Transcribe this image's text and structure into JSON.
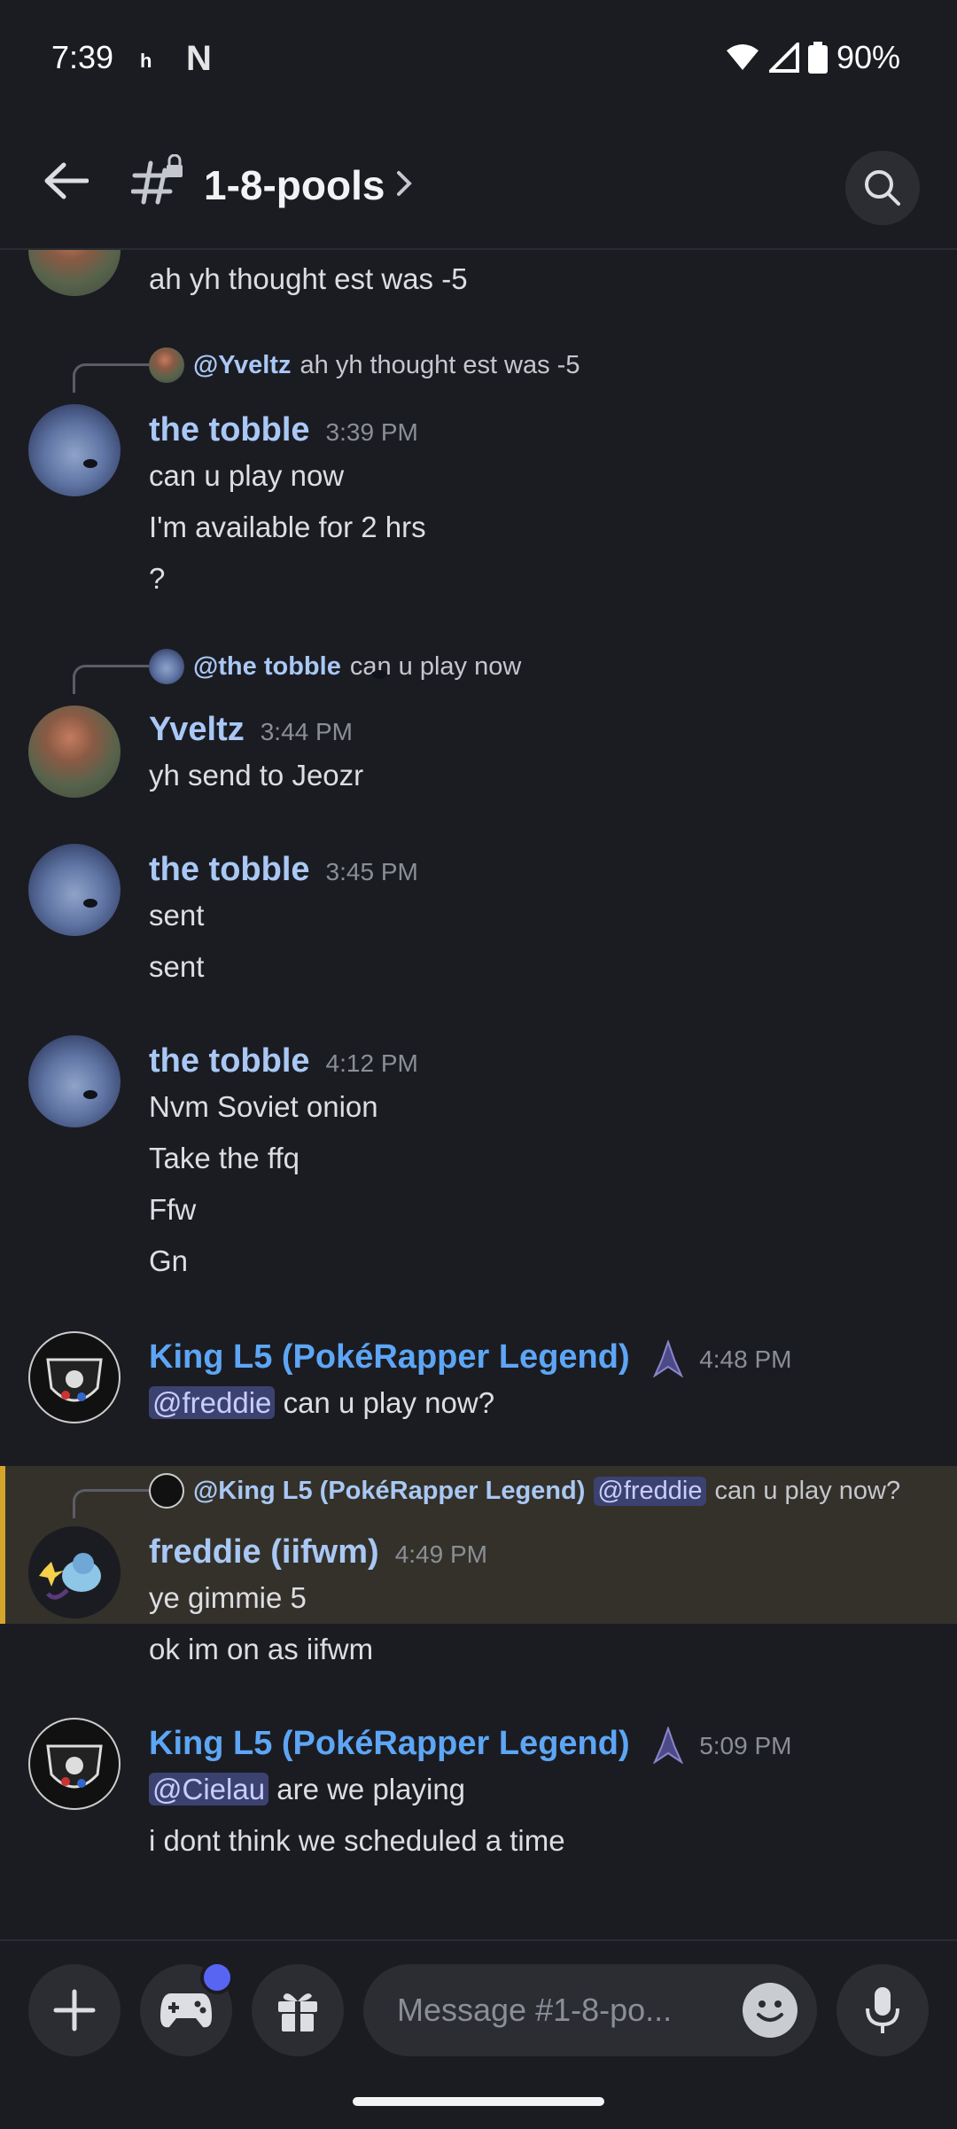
{
  "status_bar": {
    "time": "7:39",
    "app_h": "h",
    "app_n": "N",
    "battery": "90%"
  },
  "header": {
    "channel_name": "1-8-pools"
  },
  "messages": {
    "m0": {
      "text": "ah yh thought est was -5"
    },
    "m1": {
      "reply_name": "@Yveltz",
      "reply_text": "ah yh thought est was -5",
      "author": "the tobble",
      "time": "3:39 PM",
      "lines": [
        "can u play now",
        "I'm available for 2 hrs",
        "?"
      ]
    },
    "m2": {
      "reply_name": "@the tobble",
      "reply_text": "can u play now",
      "author": "Yveltz",
      "time": "3:44 PM",
      "lines": [
        "yh send to Jeozr"
      ]
    },
    "m3": {
      "author": "the tobble",
      "time": "3:45 PM",
      "lines": [
        "sent",
        "sent"
      ]
    },
    "m4": {
      "author": "the tobble",
      "time": "4:12 PM",
      "lines": [
        "Nvm Soviet onion",
        "Take the ffq",
        "Ffw",
        "Gn"
      ]
    },
    "m5": {
      "author": "King L5 (PokéRapper Legend)",
      "time": "4:48 PM",
      "mention": "@freddie",
      "text": "can u play now?"
    },
    "m6": {
      "reply_name": "@King L5 (PokéRapper Legend)",
      "reply_mention": "@freddie",
      "reply_text": "can u play now?",
      "author": "freddie (iifwm)",
      "time": "4:49 PM",
      "lines": [
        "ye gimmie 5",
        "ok im on as iifwm"
      ]
    },
    "m7": {
      "author": "King L5 (PokéRapper Legend)",
      "time": "5:09 PM",
      "mention": "@Cielau",
      "text": "are we playing",
      "line2": "i dont think we scheduled a time"
    }
  },
  "composer": {
    "placeholder": "Message #1-8-po..."
  },
  "colors": {
    "accent": "#5865f2",
    "username": "#a9c8f5",
    "highlight_bar": "#d4a52a",
    "background": "#1b1c22"
  },
  "icons": [
    "back-arrow-icon",
    "locked-channel-icon",
    "chevron-right-icon",
    "search-icon",
    "plus-icon",
    "gamepad-icon",
    "gift-icon",
    "emoji-icon",
    "microphone-icon"
  ]
}
